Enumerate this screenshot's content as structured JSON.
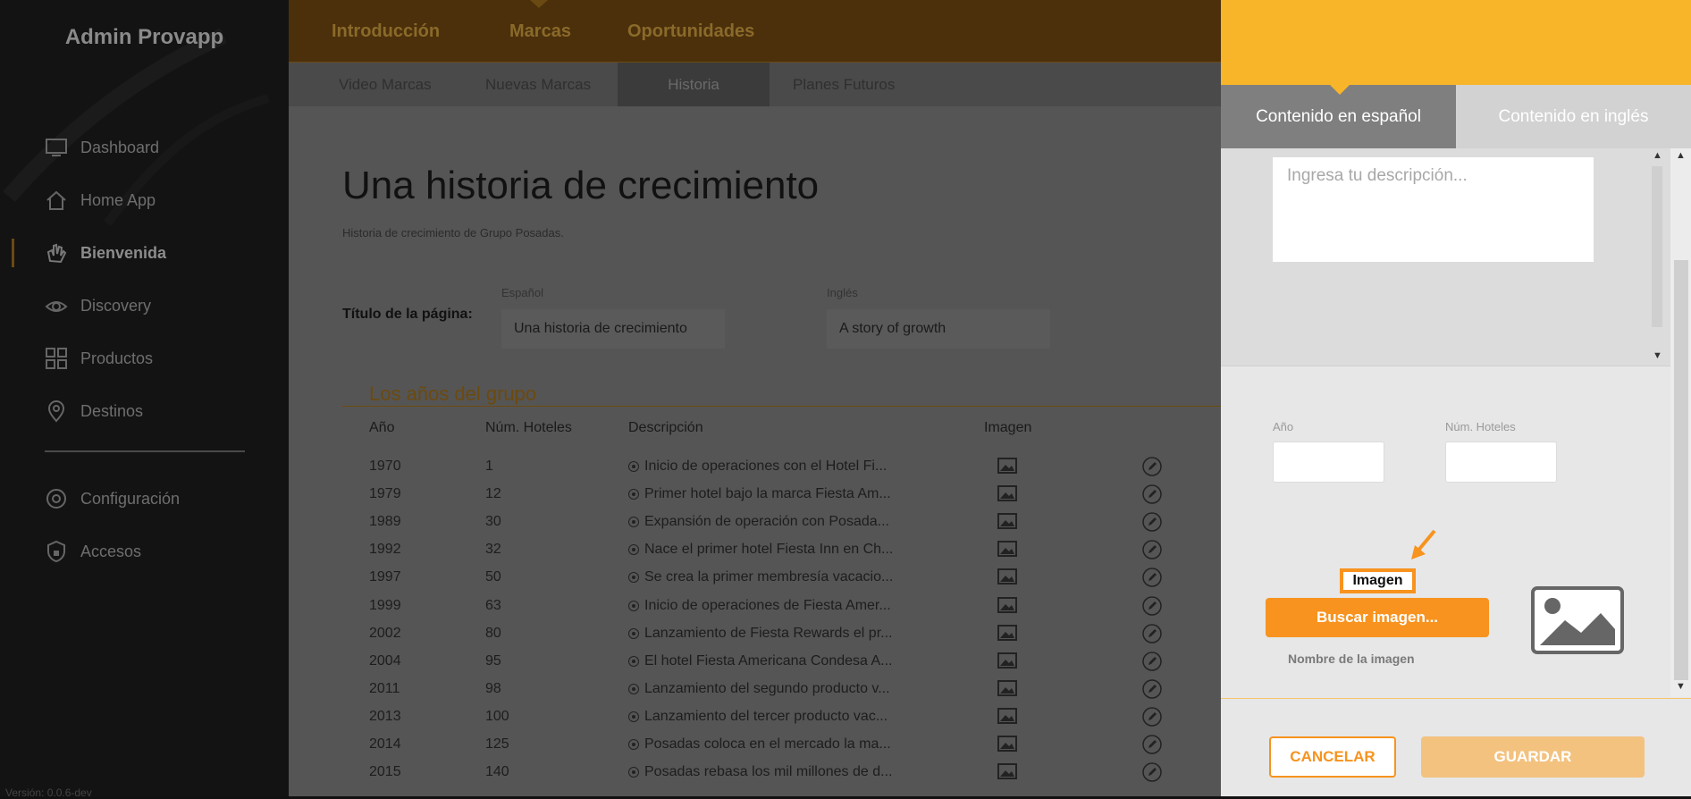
{
  "sidebar": {
    "brand": "Admin Provapp",
    "items": [
      {
        "label": "Dashboard",
        "icon": "monitor-icon"
      },
      {
        "label": "Home App",
        "icon": "home-icon"
      },
      {
        "label": "Bienvenida",
        "icon": "wave-hand-icon"
      },
      {
        "label": "Discovery",
        "icon": "eye-icon"
      },
      {
        "label": "Productos",
        "icon": "grid-icon"
      },
      {
        "label": "Destinos",
        "icon": "map-pin-icon"
      }
    ],
    "bottom_items": [
      {
        "label": "Configuración",
        "icon": "gear-icon"
      },
      {
        "label": "Accesos",
        "icon": "shield-lock-icon"
      }
    ],
    "active": "Bienvenida",
    "version": "Versión: 0.0.6-dev"
  },
  "topnav": {
    "tabs": [
      "Introducción",
      "Marcas",
      "Oportunidades"
    ],
    "active": "Marcas"
  },
  "subnav": {
    "tabs": [
      "Video Marcas",
      "Nuevas Marcas",
      "Historia",
      "Planes Futuros"
    ],
    "active": "Historia"
  },
  "page": {
    "title": "Una historia de crecimiento",
    "subtitle": "Historia de crecimiento de Grupo Posadas.",
    "page_title_label": "Título de la página:",
    "lang_es": "Español",
    "lang_en": "Inglés",
    "title_es": "Una historia de crecimiento",
    "title_en": "A story of growth",
    "section": "Los años del grupo"
  },
  "table": {
    "headers": [
      "Año",
      "Núm. Hoteles",
      "Descripción",
      "Imagen"
    ],
    "rows": [
      {
        "year": "1970",
        "hotels": "1",
        "desc": "Inicio de operaciones con el Hotel Fi..."
      },
      {
        "year": "1979",
        "hotels": "12",
        "desc": "Primer hotel bajo la marca Fiesta Am..."
      },
      {
        "year": "1989",
        "hotels": "30",
        "desc": "Expansión de operación con Posada..."
      },
      {
        "year": "1992",
        "hotels": "32",
        "desc": "Nace el primer hotel Fiesta Inn en Ch..."
      },
      {
        "year": "1997",
        "hotels": "50",
        "desc": "Se crea la primer membresía vacacio..."
      },
      {
        "year": "1999",
        "hotels": "63",
        "desc": "Inicio de operaciones de Fiesta Amer..."
      },
      {
        "year": "2002",
        "hotels": "80",
        "desc": "Lanzamiento de Fiesta Rewards el pr..."
      },
      {
        "year": "2004",
        "hotels": "95",
        "desc": "El hotel Fiesta Americana Condesa A..."
      },
      {
        "year": "2011",
        "hotels": "98",
        "desc": "Lanzamiento del segundo producto v..."
      },
      {
        "year": "2013",
        "hotels": "100",
        "desc": "Lanzamiento del tercer producto vac..."
      },
      {
        "year": "2014",
        "hotels": "125",
        "desc": "Posadas coloca en el mercado la ma..."
      },
      {
        "year": "2015",
        "hotels": "140",
        "desc": "Posadas rebasa los mil millones de d..."
      }
    ]
  },
  "panel": {
    "tab_es": "Contenido en español",
    "tab_en": "Contenido en inglés",
    "desc_placeholder": "Ingresa tu descripción...",
    "year_label": "Año",
    "hotels_label": "Núm. Hoteles",
    "image_label": "Imagen",
    "search_button": "Buscar imagen...",
    "image_name": "Nombre de la imagen",
    "cancel": "CANCELAR",
    "save": "GUARDAR"
  },
  "colors": {
    "accent": "#f7931e",
    "panel_header": "#f8b52a",
    "sidebar_bg": "#131313"
  }
}
